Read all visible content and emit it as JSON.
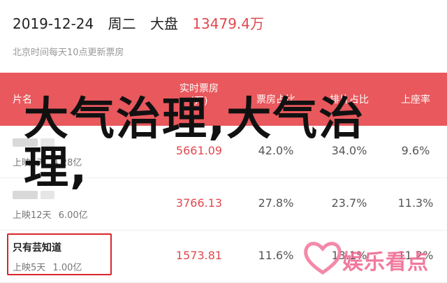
{
  "header": {
    "date": "2019-12-24",
    "weekday": "周二",
    "market_label": "大盘",
    "market_total": "13479.4万",
    "subtitle": "北京时间每天10点更新票房"
  },
  "table": {
    "columns": {
      "film": "片名",
      "realtime_box": "实时票房\n(万)",
      "box_share": "票房占比",
      "screening_share": "排片占比",
      "seat_rate": "上座率"
    },
    "rows": [
      {
        "name": "",
        "release": "上映5天",
        "cumulative": "4.28亿",
        "box": "5661.09",
        "share": "42.0%",
        "screen": "34.0%",
        "seat": "9.6%"
      },
      {
        "name": "",
        "release": "上映12天",
        "cumulative": "6.00亿",
        "box": "3766.13",
        "share": "27.8%",
        "screen": "23.7%",
        "seat": "11.3%"
      },
      {
        "name": "只有芸知道",
        "release": "上映5天",
        "cumulative": "1.00亿",
        "box": "1573.81",
        "share": "11.6%",
        "screen": "13.1%",
        "seat": "11.2%"
      }
    ]
  },
  "overlay": {
    "text": "大气治理,大气治理,"
  },
  "watermark": {
    "text": "娱乐看点"
  },
  "colors": {
    "header_bar": "#e8585d",
    "accent_red": "#e0494f",
    "highlight_border": "#d9252b",
    "watermark_pink": "#f06b93"
  }
}
